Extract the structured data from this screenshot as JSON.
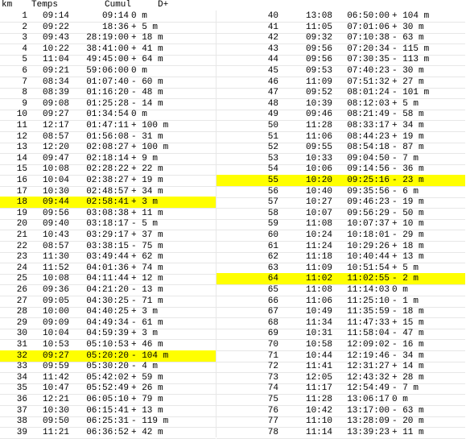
{
  "headers": {
    "km": "km",
    "temps": "Temps",
    "cumul": "Cumul",
    "dplus": "D+"
  },
  "highlight_color": "#ffff00",
  "left": [
    {
      "km": "1",
      "temps": "09:14",
      "cumul": "09:14",
      "dplus": "0 m"
    },
    {
      "km": "2",
      "temps": "09:22",
      "cumul": "18:36",
      "dplus": "+ 5 m"
    },
    {
      "km": "3",
      "temps": "09:43",
      "cumul": "28:19:00",
      "dplus": "+ 18 m"
    },
    {
      "km": "4",
      "temps": "10:22",
      "cumul": "38:41:00",
      "dplus": "+ 41 m"
    },
    {
      "km": "5",
      "temps": "11:04",
      "cumul": "49:45:00",
      "dplus": "+ 64 m"
    },
    {
      "km": "6",
      "temps": "09:21",
      "cumul": "59:06:00",
      "dplus": "0 m"
    },
    {
      "km": "7",
      "temps": "08:34",
      "cumul": "01:07:40",
      "dplus": "- 60 m"
    },
    {
      "km": "8",
      "temps": "08:39",
      "cumul": "01:16:20",
      "dplus": "- 48 m"
    },
    {
      "km": "9",
      "temps": "09:08",
      "cumul": "01:25:28",
      "dplus": "- 14 m"
    },
    {
      "km": "10",
      "temps": "09:27",
      "cumul": "01:34:54",
      "dplus": "0 m"
    },
    {
      "km": "11",
      "temps": "12:17",
      "cumul": "01:47:11",
      "dplus": "+ 100 m"
    },
    {
      "km": "12",
      "temps": "08:57",
      "cumul": "01:56:08",
      "dplus": "- 31 m"
    },
    {
      "km": "13",
      "temps": "12:20",
      "cumul": "02:08:27",
      "dplus": "+ 100 m"
    },
    {
      "km": "14",
      "temps": "09:47",
      "cumul": "02:18:14",
      "dplus": "+ 9 m"
    },
    {
      "km": "15",
      "temps": "10:08",
      "cumul": "02:28:22",
      "dplus": "+ 22 m"
    },
    {
      "km": "16",
      "temps": "10:04",
      "cumul": "02:38:27",
      "dplus": "+ 19 m"
    },
    {
      "km": "17",
      "temps": "10:30",
      "cumul": "02:48:57",
      "dplus": "+ 34 m"
    },
    {
      "km": "18",
      "temps": "09:44",
      "cumul": "02:58:41",
      "dplus": "+ 3 m",
      "hl": true
    },
    {
      "km": "19",
      "temps": "09:56",
      "cumul": "03:08:38",
      "dplus": "+ 11 m"
    },
    {
      "km": "20",
      "temps": "09:40",
      "cumul": "03:18:17",
      "dplus": "- 5 m"
    },
    {
      "km": "21",
      "temps": "10:43",
      "cumul": "03:29:17",
      "dplus": "+ 37 m"
    },
    {
      "km": "22",
      "temps": "08:57",
      "cumul": "03:38:15",
      "dplus": "- 75 m"
    },
    {
      "km": "23",
      "temps": "11:30",
      "cumul": "03:49:44",
      "dplus": "+ 62 m"
    },
    {
      "km": "24",
      "temps": "11:52",
      "cumul": "04:01:36",
      "dplus": "+ 74 m"
    },
    {
      "km": "25",
      "temps": "10:08",
      "cumul": "04:11:44",
      "dplus": "+ 12 m"
    },
    {
      "km": "26",
      "temps": "09:36",
      "cumul": "04:21:20",
      "dplus": "- 13 m"
    },
    {
      "km": "27",
      "temps": "09:05",
      "cumul": "04:30:25",
      "dplus": "- 71 m"
    },
    {
      "km": "28",
      "temps": "10:00",
      "cumul": "04:40:25",
      "dplus": "+ 3 m"
    },
    {
      "km": "29",
      "temps": "09:09",
      "cumul": "04:49:34",
      "dplus": "- 61 m"
    },
    {
      "km": "30",
      "temps": "10:04",
      "cumul": "04:59:39",
      "dplus": "+ 3 m"
    },
    {
      "km": "31",
      "temps": "10:53",
      "cumul": "05:10:53",
      "dplus": "+ 46 m"
    },
    {
      "km": "32",
      "temps": "09:27",
      "cumul": "05:20:20",
      "dplus": "- 104 m",
      "hl": true
    },
    {
      "km": "33",
      "temps": "09:59",
      "cumul": "05:30:20",
      "dplus": "- 4 m"
    },
    {
      "km": "34",
      "temps": "11:42",
      "cumul": "05:42:02",
      "dplus": "+ 59 m"
    },
    {
      "km": "35",
      "temps": "10:47",
      "cumul": "05:52:49",
      "dplus": "+ 26 m"
    },
    {
      "km": "36",
      "temps": "12:21",
      "cumul": "06:05:10",
      "dplus": "+ 79 m"
    },
    {
      "km": "37",
      "temps": "10:30",
      "cumul": "06:15:41",
      "dplus": "+ 13 m"
    },
    {
      "km": "38",
      "temps": "09:50",
      "cumul": "06:25:31",
      "dplus": "- 119 m"
    },
    {
      "km": "39",
      "temps": "11:21",
      "cumul": "06:36:52",
      "dplus": "+ 42 m"
    }
  ],
  "right": [
    {
      "km": "40",
      "temps": "13:08",
      "cumul": "06:50:00",
      "dplus": "+ 104 m"
    },
    {
      "km": "41",
      "temps": "11:05",
      "cumul": "07:01:06",
      "dplus": "+ 30 m"
    },
    {
      "km": "42",
      "temps": "09:32",
      "cumul": "07:10:38",
      "dplus": "- 63 m"
    },
    {
      "km": "43",
      "temps": "09:56",
      "cumul": "07:20:34",
      "dplus": "- 115 m"
    },
    {
      "km": "44",
      "temps": "09:56",
      "cumul": "07:30:35",
      "dplus": "- 113 m"
    },
    {
      "km": "45",
      "temps": "09:53",
      "cumul": "07:40:23",
      "dplus": "- 30 m"
    },
    {
      "km": "46",
      "temps": "11:09",
      "cumul": "07:51:32",
      "dplus": "+ 27 m"
    },
    {
      "km": "47",
      "temps": "09:52",
      "cumul": "08:01:24",
      "dplus": "- 101 m"
    },
    {
      "km": "48",
      "temps": "10:39",
      "cumul": "08:12:03",
      "dplus": "+ 5 m"
    },
    {
      "km": "49",
      "temps": "09:46",
      "cumul": "08:21:49",
      "dplus": "- 58 m"
    },
    {
      "km": "50",
      "temps": "11:28",
      "cumul": "08:33:17",
      "dplus": "+ 34 m"
    },
    {
      "km": "51",
      "temps": "11:06",
      "cumul": "08:44:23",
      "dplus": "+ 19 m"
    },
    {
      "km": "52",
      "temps": "09:55",
      "cumul": "08:54:18",
      "dplus": "- 87 m"
    },
    {
      "km": "53",
      "temps": "10:33",
      "cumul": "09:04:50",
      "dplus": "- 7 m"
    },
    {
      "km": "54",
      "temps": "10:06",
      "cumul": "09:14:56",
      "dplus": "- 36 m"
    },
    {
      "km": "55",
      "temps": "10:20",
      "cumul": "09:25:16",
      "dplus": "- 23 m",
      "hl": true
    },
    {
      "km": "56",
      "temps": "10:40",
      "cumul": "09:35:56",
      "dplus": "- 6 m"
    },
    {
      "km": "57",
      "temps": "10:27",
      "cumul": "09:46:23",
      "dplus": "- 19 m"
    },
    {
      "km": "58",
      "temps": "10:07",
      "cumul": "09:56:29",
      "dplus": "- 50 m"
    },
    {
      "km": "59",
      "temps": "11:08",
      "cumul": "10:07:37",
      "dplus": "+ 10 m"
    },
    {
      "km": "60",
      "temps": "10:24",
      "cumul": "10:18:01",
      "dplus": "- 29 m"
    },
    {
      "km": "61",
      "temps": "11:24",
      "cumul": "10:29:26",
      "dplus": "+ 18 m"
    },
    {
      "km": "62",
      "temps": "11:18",
      "cumul": "10:40:44",
      "dplus": "+ 13 m"
    },
    {
      "km": "63",
      "temps": "11:09",
      "cumul": "10:51:54",
      "dplus": "+ 5 m"
    },
    {
      "km": "64",
      "temps": "11:02",
      "cumul": "11:02:55",
      "dplus": "- 2 m",
      "hl": true
    },
    {
      "km": "65",
      "temps": "11:08",
      "cumul": "11:14:03",
      "dplus": "0 m"
    },
    {
      "km": "66",
      "temps": "11:06",
      "cumul": "11:25:10",
      "dplus": "- 1 m"
    },
    {
      "km": "67",
      "temps": "10:49",
      "cumul": "11:35:59",
      "dplus": "- 18 m"
    },
    {
      "km": "68",
      "temps": "11:34",
      "cumul": "11:47:33",
      "dplus": "+ 15 m"
    },
    {
      "km": "69",
      "temps": "10:31",
      "cumul": "11:58:04",
      "dplus": "- 47 m"
    },
    {
      "km": "70",
      "temps": "10:58",
      "cumul": "12:09:02",
      "dplus": "- 16 m"
    },
    {
      "km": "71",
      "temps": "10:44",
      "cumul": "12:19:46",
      "dplus": "- 34 m"
    },
    {
      "km": "72",
      "temps": "11:41",
      "cumul": "12:31:27",
      "dplus": "+ 14 m"
    },
    {
      "km": "73",
      "temps": "12:05",
      "cumul": "12:43:32",
      "dplus": "+ 28 m"
    },
    {
      "km": "74",
      "temps": "11:17",
      "cumul": "12:54:49",
      "dplus": "- 7 m"
    },
    {
      "km": "75",
      "temps": "11:28",
      "cumul": "13:06:17",
      "dplus": "0 m"
    },
    {
      "km": "76",
      "temps": "10:42",
      "cumul": "13:17:00",
      "dplus": "- 63 m"
    },
    {
      "km": "77",
      "temps": "11:10",
      "cumul": "13:28:09",
      "dplus": "- 20 m"
    },
    {
      "km": "78",
      "temps": "11:14",
      "cumul": "13:39:23",
      "dplus": "+ 11 m"
    }
  ]
}
